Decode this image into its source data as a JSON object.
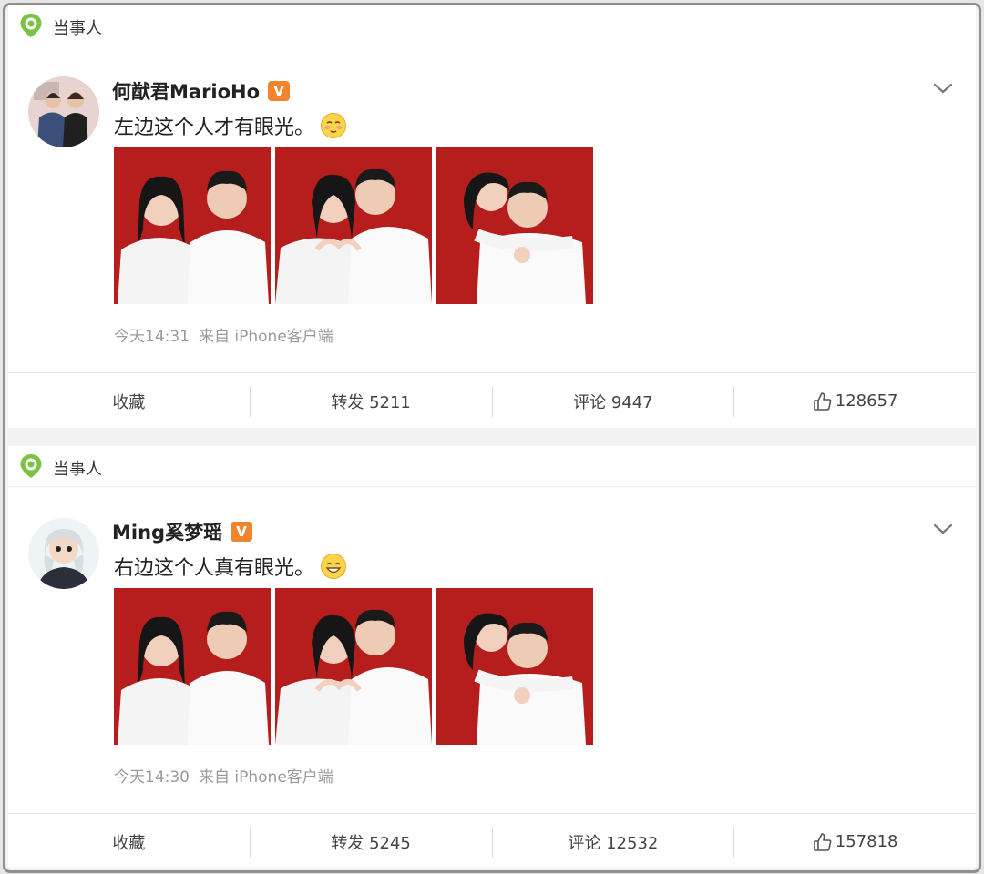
{
  "colors": {
    "accent": "#f0852d",
    "tag_green": "#7cc242",
    "bg_red": "#b61d1d"
  },
  "posts": [
    {
      "tag": "当事人",
      "user": "何猷君MarioHo",
      "verified_badge": "V",
      "text": "左边这个人才有眼光。",
      "emoji_icon": "shy-face-emoji",
      "time": "今天14:31",
      "source": "来自 iPhone客户端",
      "actions": {
        "favorite": "收藏",
        "repost": "转发 5211",
        "comment": "评论 9447",
        "like": "128657"
      }
    },
    {
      "tag": "当事人",
      "user": "Ming奚梦瑶",
      "verified_badge": "V",
      "text": "右边这个人真有眼光。",
      "emoji_icon": "smile-face-emoji",
      "time": "今天14:30",
      "source": "来自 iPhone客户端",
      "actions": {
        "favorite": "收藏",
        "repost": "转发 5245",
        "comment": "评论 12532",
        "like": "157818"
      }
    }
  ]
}
